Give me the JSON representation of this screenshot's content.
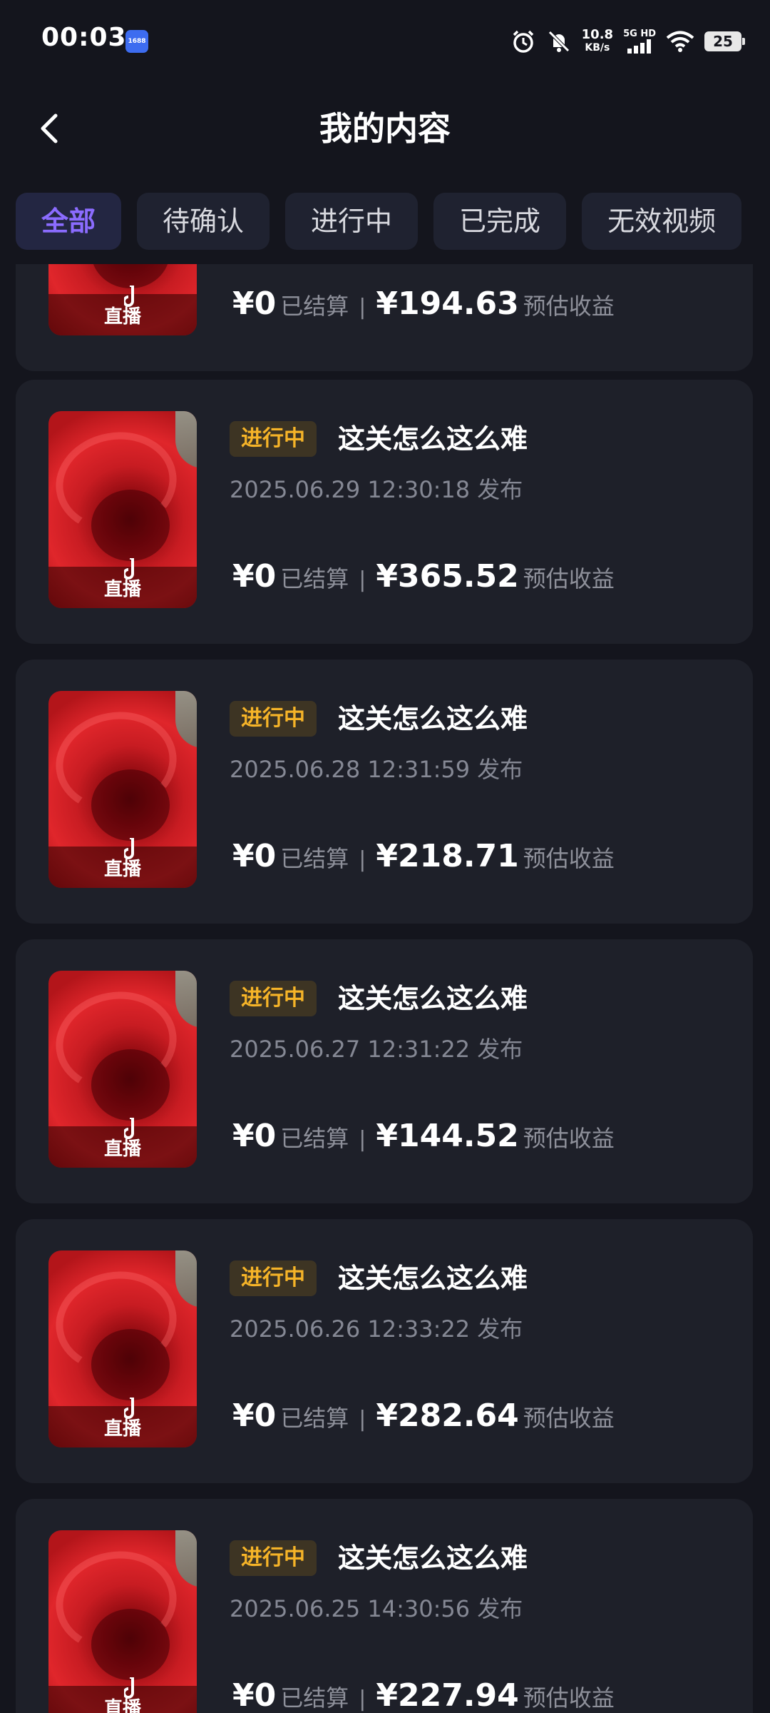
{
  "status_bar": {
    "time": "00:03",
    "app_badge": "1688",
    "net_speed_value": "10.8",
    "net_speed_unit": "KB/s",
    "signal_label": "5G HD",
    "battery": "25"
  },
  "header": {
    "title": "我的内容"
  },
  "tabs": [
    {
      "label": "全部",
      "active": true
    },
    {
      "label": "待确认",
      "active": false
    },
    {
      "label": "进行中",
      "active": false
    },
    {
      "label": "已完成",
      "active": false
    },
    {
      "label": "无效视频",
      "active": false
    }
  ],
  "items": [
    {
      "live_label": "直播",
      "status": "",
      "title": "",
      "date": "",
      "settled_amount": "¥0",
      "settled_label": "已结算",
      "divider": "|",
      "estimated_amount": "¥194.63",
      "estimated_label": "预估收益"
    },
    {
      "live_label": "直播",
      "status": "进行中",
      "title": "这关怎么这么难",
      "date": "2025.06.29 12:30:18 发布",
      "settled_amount": "¥0",
      "settled_label": "已结算",
      "divider": "|",
      "estimated_amount": "¥365.52",
      "estimated_label": "预估收益"
    },
    {
      "live_label": "直播",
      "status": "进行中",
      "title": "这关怎么这么难",
      "date": "2025.06.28 12:31:59 发布",
      "settled_amount": "¥0",
      "settled_label": "已结算",
      "divider": "|",
      "estimated_amount": "¥218.71",
      "estimated_label": "预估收益"
    },
    {
      "live_label": "直播",
      "status": "进行中",
      "title": "这关怎么这么难",
      "date": "2025.06.27 12:31:22 发布",
      "settled_amount": "¥0",
      "settled_label": "已结算",
      "divider": "|",
      "estimated_amount": "¥144.52",
      "estimated_label": "预估收益"
    },
    {
      "live_label": "直播",
      "status": "进行中",
      "title": "这关怎么这么难",
      "date": "2025.06.26 12:33:22 发布",
      "settled_amount": "¥0",
      "settled_label": "已结算",
      "divider": "|",
      "estimated_amount": "¥282.64",
      "estimated_label": "预估收益"
    },
    {
      "live_label": "直播",
      "status": "进行中",
      "title": "这关怎么这么难",
      "date": "2025.06.25 14:30:56 发布",
      "settled_amount": "¥0",
      "settled_label": "已结算",
      "divider": "|",
      "estimated_amount": "¥227.94",
      "estimated_label": "预估收益"
    }
  ]
}
